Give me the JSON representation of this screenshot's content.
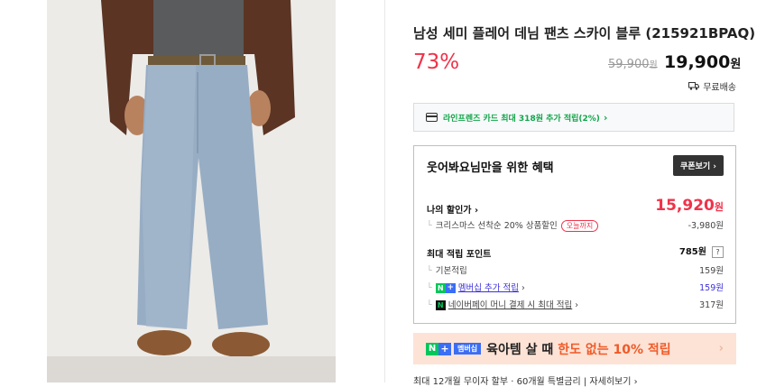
{
  "product": {
    "title": "남성 세미 플레어 데님 팬츠 스카이 블루 (215921BPAQ)",
    "discount_rate": "73%",
    "original_price": "59,900",
    "original_price_unit": "원",
    "sale_price": "19,900",
    "sale_price_unit": "원",
    "shipping": "무료배송"
  },
  "card_banner": {
    "text": "라인프렌즈 카드 최대 318원 추가 적립(2%)",
    "chevron": "›"
  },
  "benefit": {
    "title": "웃어봐요님만을 위한 혜택",
    "coupon_button": "쿠폰보기",
    "my_discount_label": "나의 할인가",
    "my_discount_price": "15,920",
    "my_discount_unit": "원",
    "christmas_label": "크리스마스 선착순 20% 상품할인",
    "today_tag": "오늘까지",
    "christmas_amount": "-3,980원",
    "max_points_label": "최대 적립 포인트",
    "max_points_value": "785원",
    "help_icon": "?",
    "basic_label": "기본적립",
    "basic_value": "159원",
    "membership_label": "멤버십 추가 적립",
    "membership_value": "159원",
    "npay_label": "네이버페이 머니 결제 시 최대 적립",
    "npay_value": "317원"
  },
  "promo": {
    "member_tag": "멤버십",
    "text": "육아템 살 때",
    "highlight": "한도 없는 10% 적립",
    "chevron": "›"
  },
  "bottom": {
    "text": "최대 12개월 무이자 할부 · 60개월 특별금리 | 자세히보기 ›"
  },
  "colors": {
    "accent_red": "#f0324a",
    "green": "#11a64b",
    "naver_green": "#03c75a",
    "membership_blue": "#3b6ef5",
    "promo_bg": "#fde3d6"
  },
  "icons": {
    "card": "card-icon",
    "truck": "truck-icon",
    "chevron": "chevron-right-icon"
  }
}
